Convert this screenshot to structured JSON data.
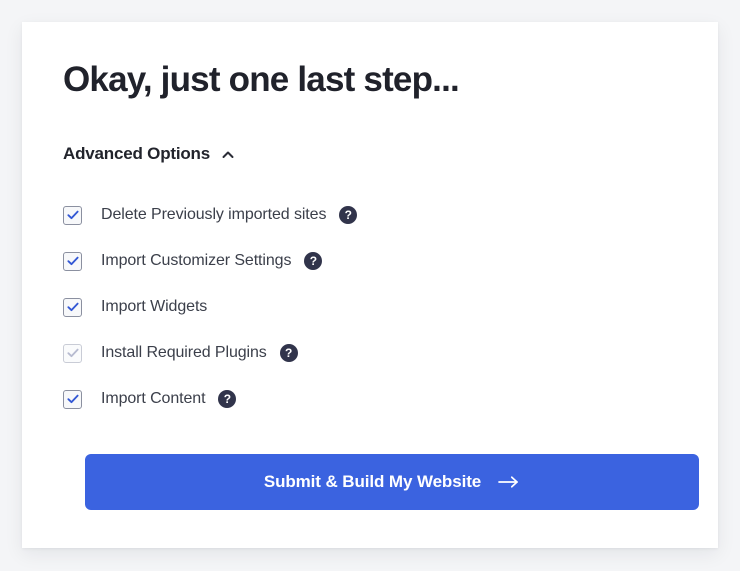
{
  "card": {
    "title": "Okay, just one last step...",
    "advanced": {
      "label": "Advanced Options",
      "chevron_icon": "chevron-up-icon",
      "expanded": true
    },
    "options": [
      {
        "label": "Delete Previously imported sites",
        "checked": true,
        "disabled": false,
        "help": true,
        "help_glyph": "?"
      },
      {
        "label": "Import Customizer Settings",
        "checked": true,
        "disabled": false,
        "help": true,
        "help_glyph": "?"
      },
      {
        "label": "Import Widgets",
        "checked": true,
        "disabled": false,
        "help": false,
        "help_glyph": "?"
      },
      {
        "label": "Install Required Plugins",
        "checked": true,
        "disabled": true,
        "help": true,
        "help_glyph": "?"
      },
      {
        "label": "Import Content",
        "checked": true,
        "disabled": false,
        "help": true,
        "help_glyph": "?"
      }
    ],
    "submit": {
      "label": "Submit & Build My Website",
      "arrow_icon": "arrow-right-icon"
    }
  },
  "colors": {
    "page_background": "#f4f5f7",
    "card_background": "#ffffff",
    "accent": "#3b63e0",
    "checkbox_tick": "#3257d4",
    "checkbox_tick_disabled": "#b7bbd0",
    "help_badge": "#31344b",
    "title_text": "#20222b",
    "label_text": "#3b3f4a"
  }
}
